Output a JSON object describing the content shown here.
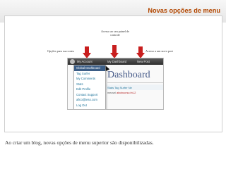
{
  "slide": {
    "title": "Novas opções de menu",
    "caption": "Ao criar um blog, novas opções de menu superior são disponibilizadas."
  },
  "annotations": {
    "middle": "Acesso ao seu painel de controle",
    "left": "Opções para sua conta",
    "right": "Acesso a um novo post"
  },
  "screenshot": {
    "topbar": {
      "items": [
        "My Account",
        "My Dashboard",
        "New Post"
      ]
    },
    "dropdown": {
      "items": [
        "Global Dashboard",
        "Tag Surfer",
        "My Comments",
        "Stats",
        "Edit Profile",
        "Contact Support",
        "afico@ieso.com",
        "Log Out"
      ]
    },
    "page_heading": "Dashboard",
    "stats_row": "Stats   Tag Surfer   Ne",
    "address_row": {
      "prefix": "mecsel ",
      "highlight": "abcinocrso.fr4-2"
    }
  },
  "colors": {
    "title": "#b34700",
    "arrow": "#c81e1e",
    "wp_topbar": "#3a3a3a",
    "dropdown_active": "#3b5d86",
    "heading": "#465a88"
  }
}
